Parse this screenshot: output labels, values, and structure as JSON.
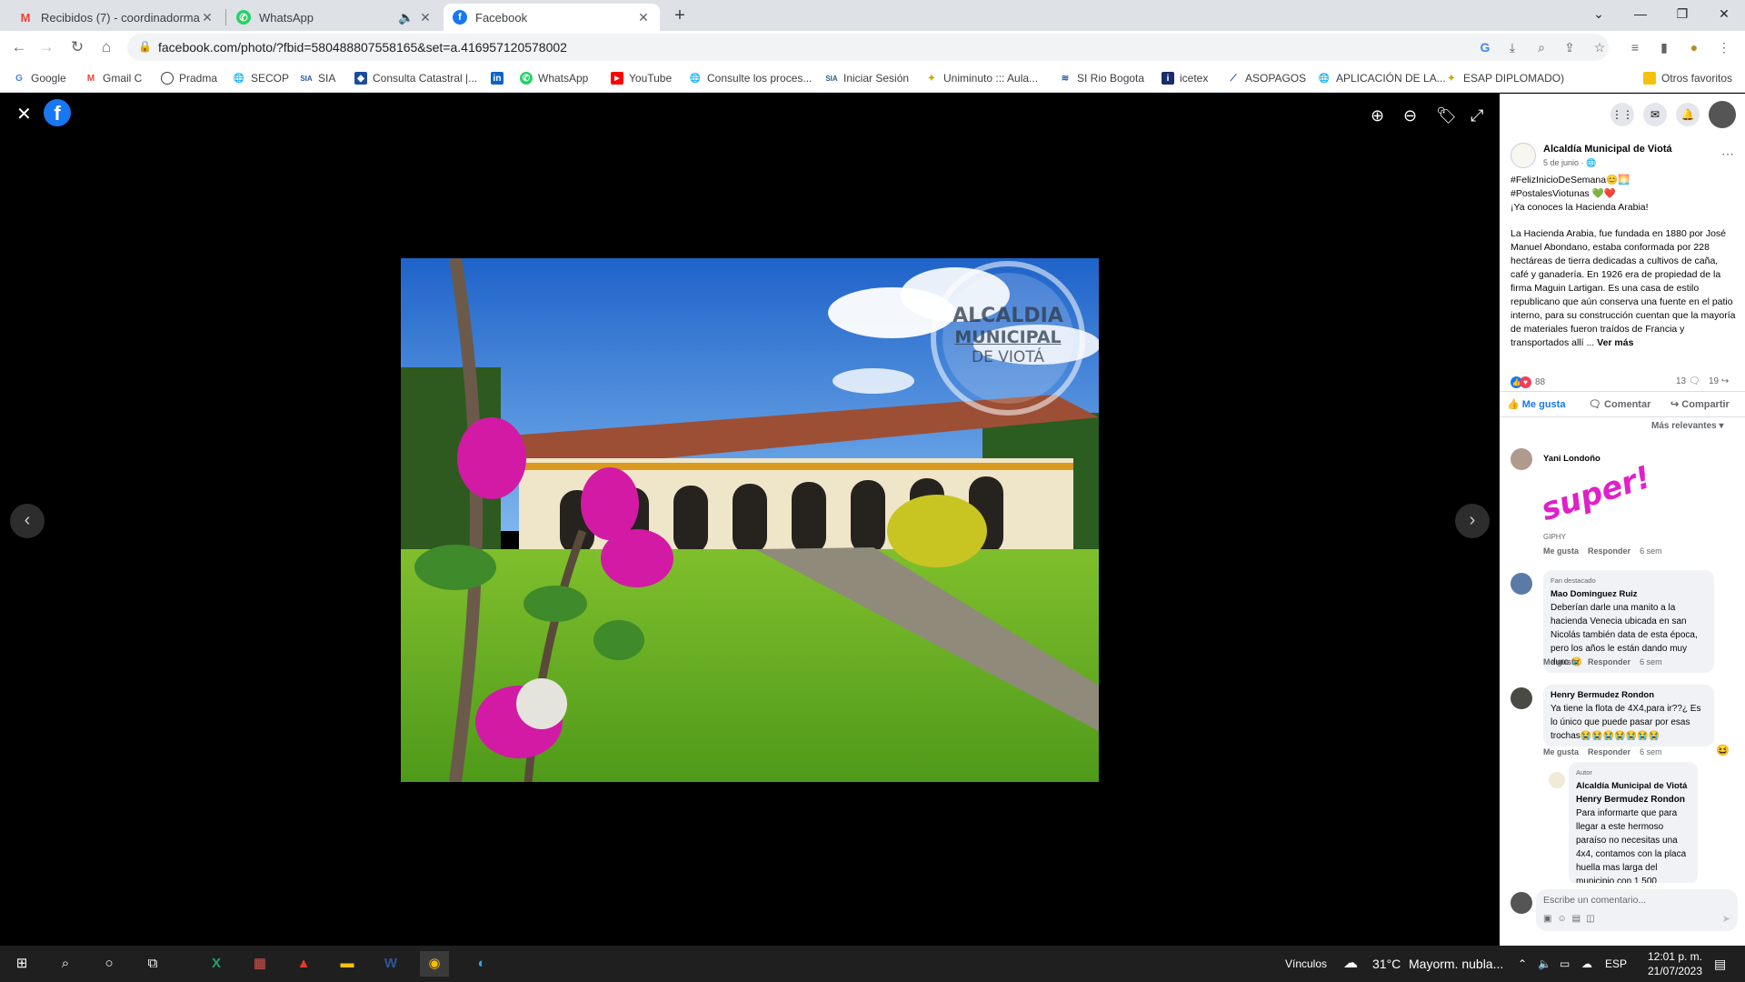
{
  "browser": {
    "tabs": [
      {
        "title": "Recibidos (7) - coordinadormam",
        "icon": "gmail-icon"
      },
      {
        "title": "WhatsApp",
        "icon": "whatsapp-icon"
      },
      {
        "title": "Facebook",
        "icon": "facebook-icon"
      }
    ],
    "url": "facebook.com/photo/?fbid=580488807558165&set=a.416957120578002",
    "bookmarks": [
      "Google",
      "Gmail C",
      "Pradma",
      "SECOP",
      "SIA",
      "Consulta Catastral |...",
      "",
      "WhatsApp",
      "YouTube",
      "Consulte los proces...",
      "Iniciar Sesión",
      "Uniminuto ::: Aula...",
      "SI Rio Bogota",
      "icetex",
      "ASOPAGOS",
      "APLICACIÓN DE LA...",
      "ESAP DIPLOMADO)"
    ],
    "other_bookmarks": "Otros favoritos"
  },
  "photo": {
    "watermark": [
      "ALCALDIA",
      "MUNICIPAL",
      "DE VIOTÁ"
    ]
  },
  "post": {
    "page_name": "Alcaldía Municipal de Viotá",
    "date": "5 de junio · ",
    "lines": [
      "#FelizInicioDeSemana😊🌅",
      "#PostalesViotunas 💚❤️",
      "¡Ya conoces la Hacienda Arabia!"
    ],
    "body": "La Hacienda Arabia, fue fundada en 1880 por José Manuel Abondano, estaba conformada por 228 hectáreas de tierra dedicadas a cultivos de caña, café y ganadería. En 1926 era de propiedad de la firma Maguin Lartigan. Es una casa de estilo republicano que aún conserva una fuente en el patio interno, para su construcción cuentan que la mayoría de materiales fueron traídos de Francia y transportados allí ...",
    "see_more": "Ver más",
    "reactions_count": "88",
    "comments_count": "13",
    "shares_count": "19",
    "like_label": "Me gusta",
    "comment_label": "Comentar",
    "share_label": "Compartir",
    "sort_label": "Más relevantes",
    "comment_placeholder": "Escribe un comentario..."
  },
  "comments": [
    {
      "name": "Yani Londoño",
      "gif": "super!",
      "gif_source": "GIPHY",
      "like": "Me gusta",
      "reply": "Responder",
      "time": "6 sem"
    },
    {
      "badge": "Fan destacado",
      "name": "Mao Dominguez Ruiz",
      "text": "Deberían darle una manito a la hacienda Venecia ubicada en san Nicolás también data de esta época, pero los años le están dando muy duro 😢",
      "like": "Me gusta",
      "reply": "Responder",
      "time": "6 sem"
    },
    {
      "name": "Henry Bermudez Rondon",
      "text": "Ya tiene la flota de 4X4,para ir??¿ Es lo único que puede pasar por esas trochas😭😭😭😭😭😭😭",
      "like": "Me gusta",
      "reply": "Responder",
      "time": "6 sem"
    },
    {
      "badge": "Autor",
      "name": "Alcaldía Municipal de Viotá",
      "mention": "Henry Bermudez Rondon",
      "text": "Para informarte que para llegar a este hermoso paraíso no necesitas una 4x4, contamos con la placa huella mas larga del municipio con 1.500"
    }
  ],
  "taskbar": {
    "links": "Vínculos",
    "temp": "31°C",
    "weather": "Mayorm. nubla...",
    "lang": "ESP",
    "time": "12:01 p. m.",
    "date": "21/07/2023"
  }
}
